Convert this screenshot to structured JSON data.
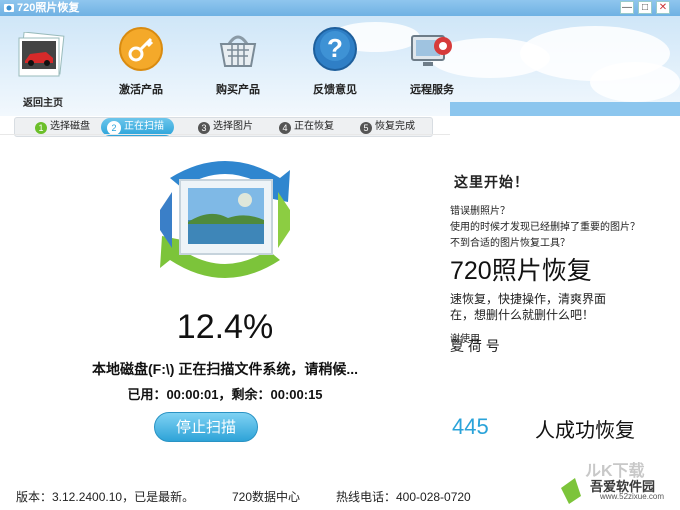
{
  "window": {
    "title": "720照片恢复",
    "min_glyph": "—",
    "max_glyph": "□",
    "close_glyph": "✕"
  },
  "toolbar": {
    "home_label": "返回主页",
    "items": [
      {
        "label": "激活产品",
        "icon": "key-icon"
      },
      {
        "label": "购买产品",
        "icon": "shopping-basket-icon"
      },
      {
        "label": "反馈意见",
        "icon": "question-icon"
      },
      {
        "label": "远程服务",
        "icon": "remote-service-icon"
      }
    ]
  },
  "steps": [
    {
      "num": "1",
      "label": "选择磁盘",
      "state": "done"
    },
    {
      "num": "2",
      "label": "正在扫描",
      "state": "active"
    },
    {
      "num": "3",
      "label": "选择图片",
      "state": "pending"
    },
    {
      "num": "4",
      "label": "正在恢复",
      "state": "pending"
    },
    {
      "num": "5",
      "label": "恢复完成",
      "state": "pending"
    }
  ],
  "scan": {
    "progress": "12.4%",
    "message": "本地磁盘(F:\\) 正在扫描文件系统，请稍候...",
    "time_line": "已用：00:00:01，剩余：00:00:15",
    "stop_label": "停止扫描"
  },
  "promo": {
    "start": "这里开始！",
    "q1": "错误删照片？",
    "q2": "使用的时候才发现已经删掉了重要的图片？",
    "q3": "不到合适的图片恢复工具？",
    "big": "720照片恢复",
    "desc1": "速恢复，快捷操作，清爽界面",
    "desc2": "在，想删什么就删什么吧！",
    "small": "谢使用",
    "trad": "夏 荷 号",
    "count": "445",
    "success": "人成功恢复"
  },
  "footer": {
    "version": "版本：3.12.2400.10，已是最新。",
    "help": "720数据中心",
    "hotline": "热线电话：400-028-0720"
  },
  "watermark": {
    "brand": "吾爱软件园",
    "url": "www.52zixue.com"
  },
  "colors": {
    "accent": "#2ea3d8",
    "step_done": "#6cbf2a",
    "step_pending": "#888888",
    "count": "#2aa3d9"
  }
}
